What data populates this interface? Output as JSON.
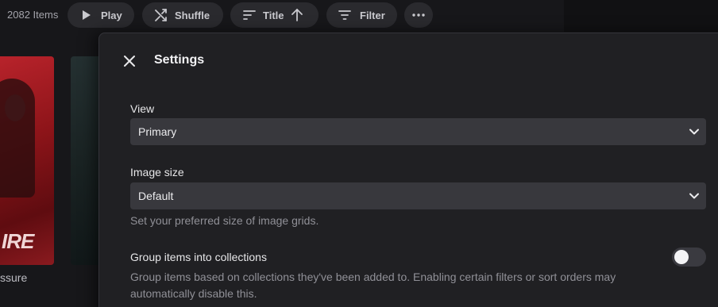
{
  "toolbar": {
    "items_count": "2082 Items",
    "play_label": "Play",
    "shuffle_label": "Shuffle",
    "sort_label": "Title",
    "filter_label": "Filter",
    "icons": [
      "play-icon",
      "shuffle-icon",
      "sort-icon",
      "arrow-up-icon",
      "filter-icon",
      "more-icon"
    ]
  },
  "background": {
    "poster_letters": "IRE",
    "poster_caption": "ssure"
  },
  "settings": {
    "title": "Settings",
    "view": {
      "label": "View",
      "value": "Primary"
    },
    "image_size": {
      "label": "Image size",
      "value": "Default",
      "help": "Set your preferred size of image grids."
    },
    "group_collections": {
      "label": "Group items into collections",
      "help_line1": "Group items based on collections they've been added to. Enabling certain filters or sort orders may",
      "help_line2": "automatically disable this.",
      "enabled": false
    }
  },
  "colors": {
    "panel_bg": "#202023",
    "select_bg": "#38383d",
    "pill_bg": "#2a2a2e",
    "toggle_off": "#3a3a40"
  }
}
